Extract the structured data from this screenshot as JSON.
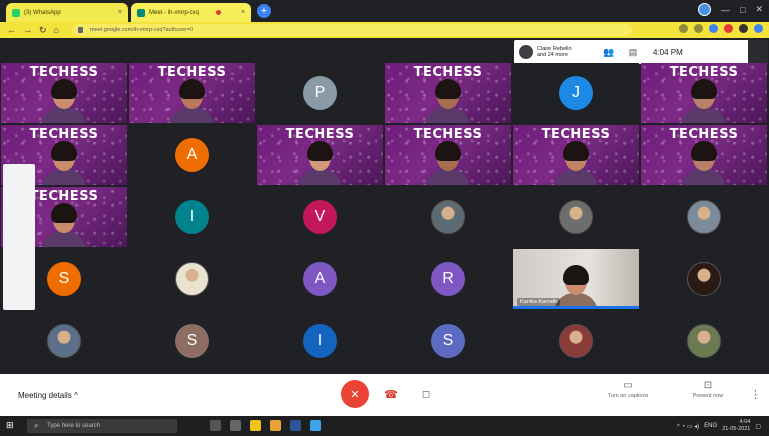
{
  "browser": {
    "tabs": [
      {
        "label": "(3) WhatsApp",
        "close": "×"
      },
      {
        "label": "Meet - ih-xmrp-cxq",
        "close": "×"
      }
    ],
    "new_tab": "+",
    "window_controls": {
      "minimize": "—",
      "maximize": "□",
      "close": "✕"
    },
    "nav": {
      "back": "←",
      "forward": "→",
      "reload": "↻",
      "home": "⌂"
    },
    "url": "meet.google.com/ih-xmrp-cxq?authuser=0"
  },
  "meet": {
    "owner_name": "Claire Rebello",
    "others_label": "and 24 more",
    "time": "4:04 PM",
    "brand_text": "TECHESS",
    "brand_text_mirrored": "TECHESS",
    "tiles": [
      {
        "kind": "video",
        "brand": "TECHESS"
      },
      {
        "kind": "video",
        "brand": "TECHESS"
      },
      {
        "kind": "avatar",
        "letter": "P",
        "color": "#8a9aa6"
      },
      {
        "kind": "video",
        "brand": "TECHESS"
      },
      {
        "kind": "avatar",
        "letter": "J",
        "color": "#1e88e5"
      },
      {
        "kind": "video",
        "brand": "TECHESS"
      },
      {
        "kind": "video",
        "brand": "TECHESS"
      },
      {
        "kind": "avatar",
        "letter": "A",
        "color": "#ef6c00"
      },
      {
        "kind": "video",
        "brand": "TECHESS"
      },
      {
        "kind": "video",
        "brand": "TECHESS"
      },
      {
        "kind": "video",
        "brand": "TECHESS"
      },
      {
        "kind": "video",
        "brand": "TECHESS"
      },
      {
        "kind": "video",
        "brand": "TECHESS"
      },
      {
        "kind": "avatar",
        "letter": "I",
        "color": "#00838f"
      },
      {
        "kind": "avatar",
        "letter": "V",
        "color": "#c2185b"
      },
      {
        "kind": "photo",
        "color": "#5c6b73"
      },
      {
        "kind": "photo",
        "color": "#6d6d6d"
      },
      {
        "kind": "photo",
        "color": "#7b8b99"
      },
      {
        "kind": "avatar",
        "letter": "S",
        "color": "#ef6c00"
      },
      {
        "kind": "photo",
        "color": "#e8e2cf"
      },
      {
        "kind": "avatar",
        "letter": "A",
        "color": "#7e57c2"
      },
      {
        "kind": "avatar",
        "letter": "R",
        "color": "#7e57c2"
      },
      {
        "kind": "selfcam",
        "name": "Kanika Kamath"
      },
      {
        "kind": "photo",
        "color": "#2a1a14"
      },
      {
        "kind": "photo",
        "color": "#5b6f8a"
      },
      {
        "kind": "avatar",
        "letter": "S",
        "color": "#8d6e63"
      },
      {
        "kind": "avatar",
        "letter": "I",
        "color": "#1565c0"
      },
      {
        "kind": "avatar",
        "letter": "S",
        "color": "#5c6bc0"
      },
      {
        "kind": "photo",
        "color": "#8b3a3a"
      },
      {
        "kind": "photo",
        "color": "#6a7a52"
      }
    ]
  },
  "controls": {
    "meeting_details": "Meeting details",
    "meeting_details_chevron": "^",
    "mic_icon": "mic-off",
    "hangup_icon": "phone-hangup",
    "camera_icon": "camera",
    "captions_label": "Turn on captions",
    "present_label": "Present now",
    "more": "⋮"
  },
  "taskbar": {
    "search_placeholder": "Type here to search",
    "time": "4:04",
    "date": "21-05-2021",
    "language": "ENG"
  }
}
